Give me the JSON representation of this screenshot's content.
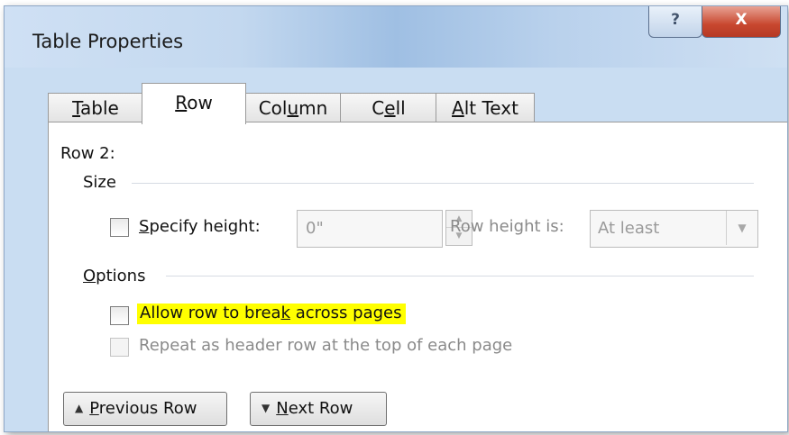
{
  "window": {
    "title": "Table Properties",
    "help_glyph": "?",
    "close_glyph": "X"
  },
  "tabs": [
    {
      "label": "Table",
      "mnemonic": "T",
      "rest": "able",
      "active": false
    },
    {
      "label": "Row",
      "mnemonic": "R",
      "rest": "ow",
      "active": true
    },
    {
      "label": "Column",
      "before": "Col",
      "mnemonic": "u",
      "rest": "mn",
      "active": false
    },
    {
      "label": "Cell",
      "before": "C",
      "mnemonic": "e",
      "rest": "ll",
      "active": false
    },
    {
      "label": "Alt Text",
      "mnemonic": "A",
      "rest": "lt Text",
      "active": false
    }
  ],
  "row_panel": {
    "row_label": "Row 2:",
    "size_section": {
      "label": "Size",
      "specify_height": {
        "mnemonic": "S",
        "rest": "pecify height:",
        "checked": false
      },
      "height_value": "0\"",
      "row_height_is_label": "Row height is:",
      "row_height_is_value": "At least"
    },
    "options_section": {
      "label": "Options",
      "label_mnemonic": "O",
      "label_rest": "ptions",
      "allow_break": {
        "before": "Allow row to brea",
        "mnemonic": "k",
        "after": " across pages",
        "checked": false,
        "highlight_color": "#ffff00"
      },
      "repeat_header": {
        "label": "Repeat as header row at the top of each page",
        "checked": false,
        "enabled": false
      }
    }
  },
  "buttons": {
    "previous": {
      "mnemonic": "P",
      "rest": "revious Row",
      "arrow": "▲"
    },
    "next": {
      "mnemonic": "N",
      "rest": "ext Row",
      "arrow": "▼"
    }
  },
  "colors": {
    "titlebar": "#c9ddf2",
    "close_button": "#c8472f",
    "highlight": "#ffff00"
  }
}
